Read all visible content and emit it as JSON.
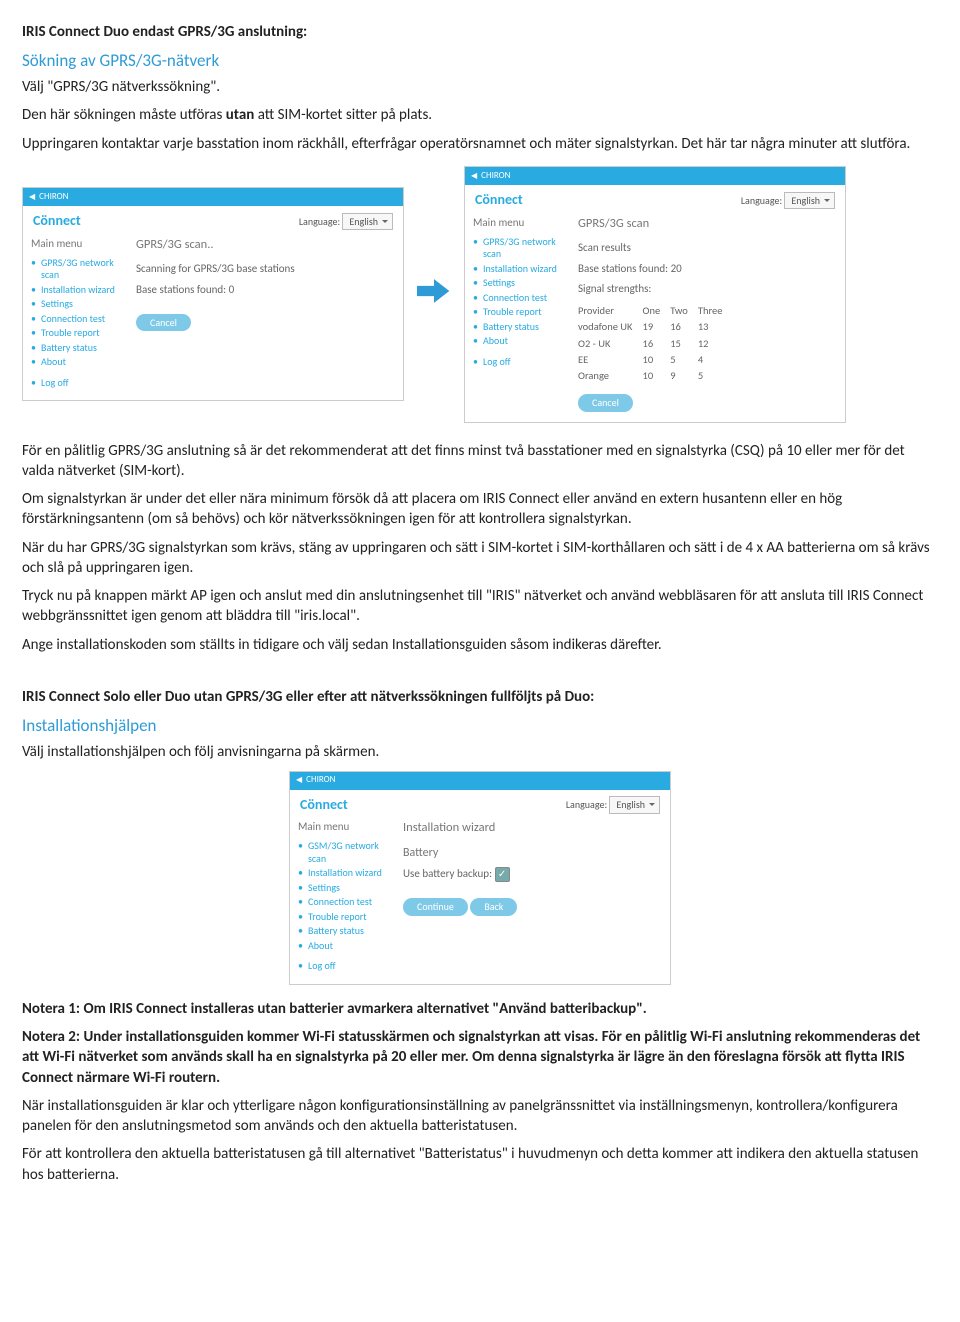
{
  "section1": {
    "heading_bold": "IRIS Connect Duo endast GPRS/3G anslutning:",
    "subheading": "Sökning av GPRS/3G-nätverk",
    "p1_a": "Välj \"GPRS/3G nätverkssökning\".",
    "p2": "Den här sökningen måste utföras utan att SIM-kortet sitter på plats.",
    "p3": "Uppringaren kontaktar varje basstation inom räckhåll, efterfrågar operatörsnamnet och mäter signalstyrkan. Det här tar några minuter att slutföra."
  },
  "panel_common": {
    "logo": "Cönnect",
    "lang_label": "Language:",
    "lang_value": "English",
    "main_menu": "Main menu",
    "nav": [
      "GPRS/3G network scan",
      "Installation wizard",
      "Settings",
      "Connection test",
      "Trouble report",
      "Battery status",
      "About"
    ],
    "logoff": "Log off",
    "cancel": "Cancel"
  },
  "panelA": {
    "title": "GPRS/3G scan..",
    "line1": "Scanning for GPRS/3G base stations",
    "line2": "Base stations found:  0"
  },
  "panelB": {
    "title": "GPRS/3G scan",
    "sub1": "Scan results",
    "sub2": "Base stations found:  20",
    "sub3": "Signal strengths:",
    "cols": [
      "Provider",
      "One",
      "Two",
      "Three"
    ],
    "rows": [
      [
        "vodafone UK",
        "19",
        "16",
        "13"
      ],
      [
        "O2 - UK",
        "16",
        "15",
        "12"
      ],
      [
        "EE",
        "10",
        "5",
        "4"
      ],
      [
        "Orange",
        "10",
        "9",
        "5"
      ]
    ]
  },
  "midtext": {
    "p1": "För en pålitlig GPRS/3G anslutning så är det rekommenderat att det finns minst två basstationer med en signalstyrka (CSQ) på 10 eller mer för det valda nätverket (SIM-kort).",
    "p2": "Om signalstyrkan är under det eller nära minimum försök då att placera om IRIS Connect eller använd en extern husantenn eller en hög förstärkningsantenn (om så behövs) och kör nätverkssökningen igen för att kontrollera signalstyrkan.",
    "p3": "När du har GPRS/3G signalstyrkan som krävs, stäng av uppringaren och sätt i SIM-kortet i SIM-korthållaren och sätt i de 4 x AA batterierna om så krävs och slå på uppringaren igen.",
    "p4": "Tryck nu på knappen märkt AP igen och anslut med din anslutningsenhet till \"IRIS\" nätverket och använd webbläsaren för att ansluta till IRIS Connect webbgränssnittet igen genom att bläddra till \"iris.local\".",
    "p5": "Ange installationskoden som ställts in tidigare och välj sedan Installationsguiden såsom indikeras därefter."
  },
  "section2": {
    "heading_bold": "IRIS Connect Solo eller Duo utan GPRS/3G eller efter att nätverkssökningen fullföljts på Duo:",
    "subheading": "Installationshjälpen",
    "p1": "Välj installationshjälpen och följ anvisningarna på skärmen."
  },
  "panelC": {
    "nav": [
      "GSM/3G network scan",
      "Installation wizard",
      "Settings",
      "Connection test",
      "Trouble report",
      "Battery status",
      "About"
    ],
    "title": "Installation wizard",
    "line1": "Battery",
    "line2": "Use battery backup:",
    "btn1": "Continue",
    "btn2": "Back"
  },
  "bottom": {
    "n1": "Notera 1: Om IRIS Connect installeras utan batterier avmarkera alternativet \"Använd batteribackup\".",
    "n2": "Notera 2: Under installationsguiden kommer Wi-Fi statusskärmen och signalstyrkan att visas. För en pålitlig Wi-Fi anslutning rekommenderas det att Wi-Fi nätverket som används skall ha en signalstyrka på 20 eller mer. Om denna signalstyrka är lägre än den föreslagna försök att flytta IRIS Connect närmare Wi-Fi routern.",
    "p1": "När installationsguiden är klar och ytterligare någon konfigurationsinställning av panelgränssnittet via inställningsmenyn, kontrollera/konfigurera panelen för den anslutningsmetod som används och den aktuella batteristatusen.",
    "p2": "För att kontrollera den aktuella batteristatusen gå till alternativet \"Batteristatus\" i huvudmenyn och detta kommer att indikera den aktuella statusen hos batterierna."
  }
}
